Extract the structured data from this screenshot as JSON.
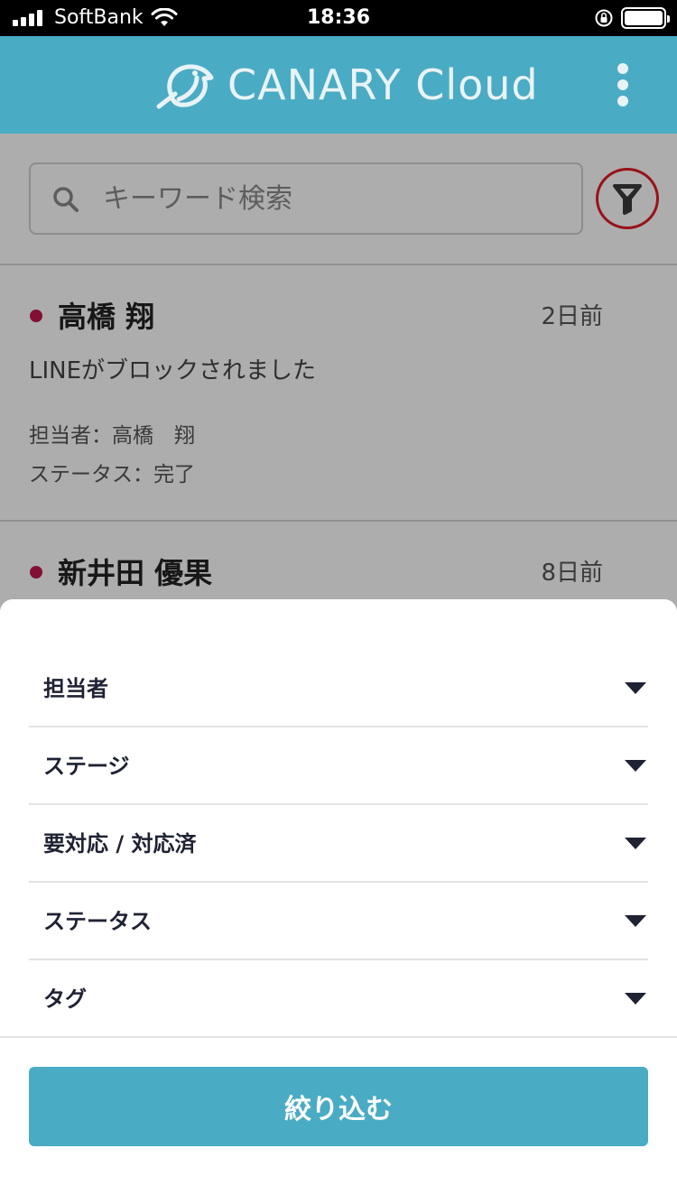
{
  "status_bar": {
    "carrier": "SoftBank",
    "time": "18:36",
    "icons": [
      "signal-icon",
      "wifi-icon",
      "rotation-lock-icon",
      "battery-icon"
    ]
  },
  "header": {
    "brand": "CANARY Cloud",
    "logo_icon": "canary-bird-icon",
    "menu_icon": "more-vertical-icon"
  },
  "search": {
    "placeholder": "キーワード検索",
    "value": "",
    "icon": "search-icon",
    "filter_icon": "filter-funnel-icon"
  },
  "list": [
    {
      "name": "高橋 翔",
      "time": "2日前",
      "message": "LINEがブロックされました",
      "assignee": "担当者：高橋　翔",
      "status": "ステータス：完了",
      "unread_color": "#c0194d"
    },
    {
      "name": "新井田 優果",
      "time": "8日前",
      "unread_color": "#c0194d"
    }
  ],
  "filter_sheet": {
    "rows": [
      {
        "label": "担当者"
      },
      {
        "label": "ステージ"
      },
      {
        "label": "要対応 / 対応済"
      },
      {
        "label": "ステータス"
      },
      {
        "label": "タグ"
      }
    ],
    "apply_label": "絞り込む"
  },
  "colors": {
    "brand": "#4aabc4",
    "highlight_ring": "#e01b24",
    "text_dark": "#1f2233"
  }
}
